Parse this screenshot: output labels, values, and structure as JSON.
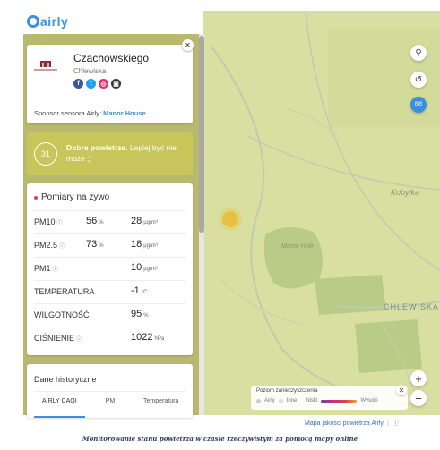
{
  "brand": {
    "logo_text": "airly"
  },
  "sensor": {
    "name": "Czachowskiego",
    "city": "Chlewiska",
    "sponsor_prefix": "Sponsor sensora Airly:",
    "sponsor_name": "Manor House",
    "socials": [
      {
        "icon": "facebook-icon",
        "glyph": "f",
        "color": "#3b5998"
      },
      {
        "icon": "twitter-icon",
        "glyph": "t",
        "color": "#1da1f2"
      },
      {
        "icon": "instagram-icon",
        "glyph": "◎",
        "color": "#e1306c"
      },
      {
        "icon": "web-icon",
        "glyph": "▣",
        "color": "#333333"
      }
    ]
  },
  "quality": {
    "caqi": "31",
    "bold": "Dobre powietrze.",
    "rest": "Lepiej być nie może ;)",
    "color": "#c8c65a"
  },
  "live": {
    "title": "Pomiary na żywo",
    "rows": [
      {
        "label": "PM10",
        "info": "ⓘ",
        "pct": "56",
        "pct_unit": "%",
        "value": "28",
        "unit": "µg/m³"
      },
      {
        "label": "PM2.5",
        "info": "ⓘ",
        "pct": "73",
        "pct_unit": "%",
        "value": "18",
        "unit": "µg/m³"
      },
      {
        "label": "PM1",
        "info": "ⓘ",
        "pct": "",
        "pct_unit": "",
        "value": "10",
        "unit": "µg/m³"
      },
      {
        "label": "TEMPERATURA",
        "info": "",
        "pct": "",
        "pct_unit": "",
        "value": "-1",
        "unit": "°C"
      },
      {
        "label": "WILGOTNOŚĆ",
        "info": "",
        "pct": "",
        "pct_unit": "",
        "value": "95",
        "unit": "%"
      },
      {
        "label": "CIŚNIENIE",
        "info": "ⓘ",
        "pct": "",
        "pct_unit": "",
        "value": "1022",
        "unit": "hPa"
      }
    ]
  },
  "history": {
    "title": "Dane historyczne",
    "tabs": [
      "AIRLY CAQI",
      "PM",
      "Temperatura"
    ]
  },
  "map": {
    "labels": {
      "kobylka": "Kobyłka",
      "marne": "Marne Hole",
      "chlewiska": "CHLEWISKA"
    },
    "legend_title": "Poziom zanieczyszczenia",
    "legend_airly": "Airly",
    "legend_inne": "Inne",
    "legend_low": "Niski",
    "legend_high": "Wysoki",
    "attribution": "Mapa jakości powietrza Airly",
    "attribution_info": "ⓘ",
    "zoom_in": "+",
    "zoom_out": "−"
  },
  "caption": "Monitorowanie stanu powietrza w czasie rzeczywistym za pomocą mapy online"
}
